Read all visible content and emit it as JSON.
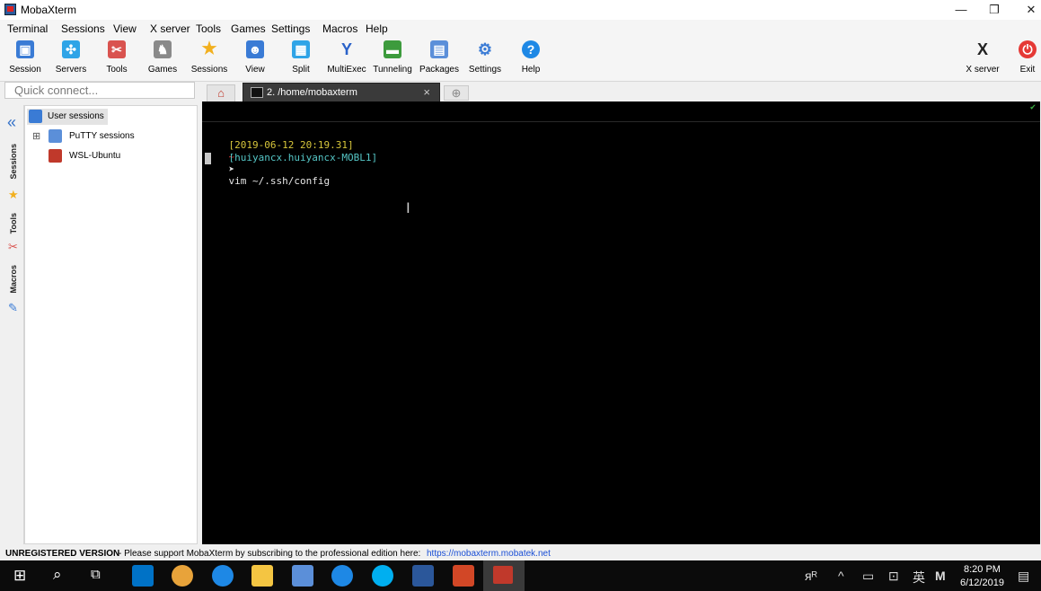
{
  "window": {
    "title": "MobaXterm",
    "controls": {
      "minimize": "—",
      "restore": "❐",
      "close": "✕"
    }
  },
  "menu": [
    "Terminal",
    "Sessions",
    "View",
    "X server",
    "Tools",
    "Games",
    "Settings",
    "Macros",
    "Help"
  ],
  "toolbar": {
    "buttons": [
      {
        "label": "Session",
        "icon": "session-icon",
        "color": "#3a7bd5"
      },
      {
        "label": "Servers",
        "icon": "servers-icon",
        "color": "#2fa4e7"
      },
      {
        "label": "Tools",
        "icon": "tools-icon",
        "color": "#d9534f"
      },
      {
        "label": "Games",
        "icon": "games-icon",
        "color": "#8a8a8a"
      },
      {
        "label": "Sessions",
        "icon": "star-icon",
        "color": "#f2b01e"
      },
      {
        "label": "View",
        "icon": "view-icon",
        "color": "#3a7bd5"
      },
      {
        "label": "Split",
        "icon": "split-icon",
        "color": "#2fa4e7"
      },
      {
        "label": "MultiExec",
        "icon": "multiexec-icon",
        "color": "#2a62c9"
      },
      {
        "label": "Tunneling",
        "icon": "tunneling-icon",
        "color": "#3d9b3d"
      },
      {
        "label": "Packages",
        "icon": "packages-icon",
        "color": "#5b8fd9"
      },
      {
        "label": "Settings",
        "icon": "settings-icon",
        "color": "#3a7bd5"
      },
      {
        "label": "Help",
        "icon": "help-icon",
        "color": "#1e88e5"
      }
    ],
    "right_buttons": [
      {
        "label": "X server",
        "icon": "x-server-icon",
        "color": "#222222"
      },
      {
        "label": "Exit",
        "icon": "power-icon",
        "color": "#e53935"
      }
    ]
  },
  "quick_connect": {
    "placeholder": "Quick connect..."
  },
  "tabs": {
    "active": {
      "label": "2. /home/mobaxterm",
      "close": "×"
    },
    "home_icon": "home-icon",
    "new_tab_icon": "new-tab-icon"
  },
  "side_tabs": [
    "Sessions",
    "Tools",
    "Macros"
  ],
  "sessions_tree": {
    "root": "User sessions",
    "expander": "⊞",
    "items": [
      "PuTTY sessions",
      "WSL-Ubuntu"
    ]
  },
  "terminal": {
    "timestamp": "[2019-06-12 20:19.31]",
    "tilde": "~",
    "prompt": "[huiyancx.huiyancx-MOBL1]",
    "arrow": "➤",
    "command": "vim ~/.ssh/config",
    "colors": {
      "timestamp": "#d7c63b",
      "prompt": "#55c6c6",
      "tilde": "#d23a3a",
      "text": "#e6e6e6"
    }
  },
  "status": {
    "label": "UNREGISTERED VERSION",
    "message": " -  Please support MobaXterm by subscribing to the professional edition here:",
    "link": "https://mobaxterm.mobatek.net"
  },
  "taskbar": {
    "time": "8:20 PM",
    "date": "6/12/2019",
    "ime": "英",
    "ime2": "M",
    "tray_people": "ᴙᴿ",
    "tray_caret": "^"
  }
}
